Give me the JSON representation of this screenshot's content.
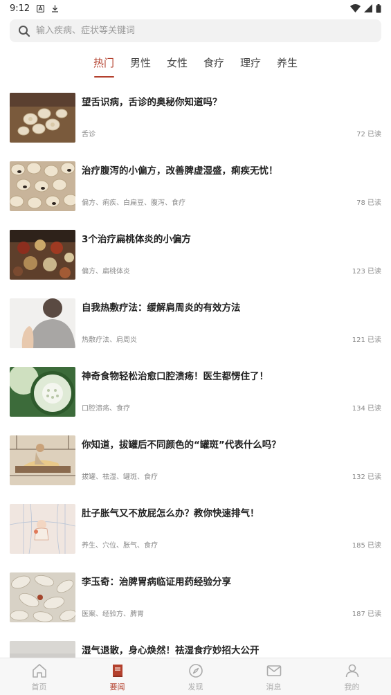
{
  "status_bar": {
    "time": "9:12"
  },
  "search": {
    "placeholder": "输入疾病、症状等关键词"
  },
  "tabs": [
    {
      "label": "热门",
      "active": true
    },
    {
      "label": "男性",
      "active": false
    },
    {
      "label": "女性",
      "active": false
    },
    {
      "label": "食疗",
      "active": false
    },
    {
      "label": "理疗",
      "active": false
    },
    {
      "label": "养生",
      "active": false
    }
  ],
  "articles": [
    {
      "title": "望舌识病，舌诊的奥秘你知道吗？",
      "tags": "舌诊",
      "reads": "72 已读",
      "thumb": "herb-slices"
    },
    {
      "title": "治疗腹泻的小偏方，改善脾虚湿盛，痢疾无忧！",
      "tags": "偏方、痢疾、白扁豆、腹泻、食疗",
      "reads": "78 已读",
      "thumb": "beans"
    },
    {
      "title": "3个治疗扁桃体炎的小偏方",
      "tags": "偏方、扁桃体炎",
      "reads": "123 已读",
      "thumb": "herb-bowls"
    },
    {
      "title": "自我热敷疗法：缓解肩周炎的有效方法",
      "tags": "热敷疗法、肩周炎",
      "reads": "121 已读",
      "thumb": "shoulder"
    },
    {
      "title": "神奇食物轻松治愈口腔溃疡！医生都愣住了！",
      "tags": "口腔溃疡、食疗",
      "reads": "134 已读",
      "thumb": "melon"
    },
    {
      "title": "你知道，拔罐后不同颜色的“罐斑”代表什么吗？",
      "tags": "拔罐、祛湿、罐斑、食疗",
      "reads": "132 已读",
      "thumb": "cupping"
    },
    {
      "title": "肚子胀气又不放屁怎么办？教你快速排气！",
      "tags": "养生、穴位、胀气、食疗",
      "reads": "185 已读",
      "thumb": "meridian"
    },
    {
      "title": "李玉奇：治脾胃病临证用药经验分享",
      "tags": "医案、经验方、脾胃",
      "reads": "187 已读",
      "thumb": "herb-pile"
    },
    {
      "title": "湿气退散，身心焕然！祛湿食疗妙招大公开",
      "tags": "",
      "reads": "",
      "thumb": "grey"
    }
  ],
  "bottom_nav": [
    {
      "label": "首页",
      "icon": "home-icon",
      "active": false
    },
    {
      "label": "要闻",
      "icon": "book-icon",
      "active": true
    },
    {
      "label": "发现",
      "icon": "compass-icon",
      "active": false
    },
    {
      "label": "消息",
      "icon": "mail-icon",
      "active": false
    },
    {
      "label": "我的",
      "icon": "user-icon",
      "active": false
    }
  ],
  "colors": {
    "accent": "#b3402d",
    "inactive": "#aaaaaa"
  }
}
